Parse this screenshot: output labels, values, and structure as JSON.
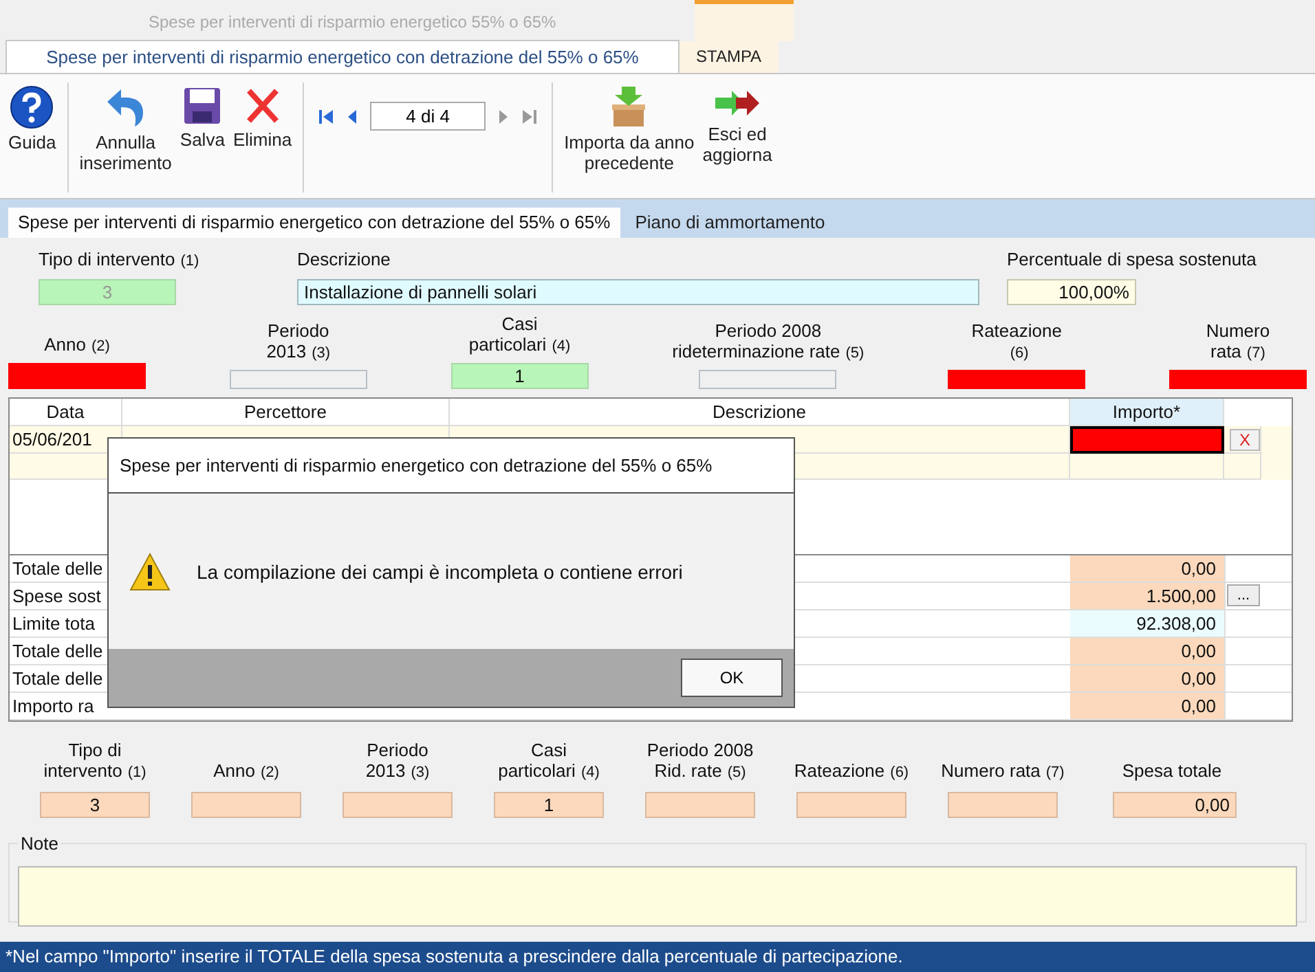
{
  "window": {
    "title": "Spese per interventi di risparmio energetico 55% o 65%"
  },
  "ribbon_tabs": [
    {
      "label": "Spese per interventi di risparmio energetico con detrazione del 55% o 65%",
      "selected": true
    },
    {
      "label": "STAMPA",
      "selected": false
    }
  ],
  "toolbar": {
    "groups": [
      [
        {
          "kind": "help",
          "label": "Guida"
        }
      ],
      [
        {
          "kind": "undo",
          "label": "Annulla\ninserimento"
        },
        {
          "kind": "save",
          "label": "Salva"
        },
        {
          "kind": "delete",
          "label": "Elimina"
        }
      ],
      [
        {
          "kind": "navigator",
          "value": "4 di 4"
        }
      ],
      [
        {
          "kind": "import",
          "label": "Importa da anno\nprecedente"
        },
        {
          "kind": "exit",
          "label": "Esci ed\naggiorna"
        }
      ]
    ]
  },
  "page_tabs": [
    {
      "label": "Spese per interventi di risparmio energetico con detrazione del 55% o 65%",
      "selected": true
    },
    {
      "label": "Piano di ammortamento",
      "selected": false
    }
  ],
  "header_fields": [
    {
      "label": "Tipo di intervento",
      "ref": "(1)",
      "value": "3",
      "kind": "ok",
      "disabled": true
    },
    {
      "label": "Descrizione",
      "value": "Installazione di pannelli solari",
      "kind": "info",
      "disabled": false
    },
    {
      "label": "Percentuale di spesa sostenuta",
      "value": "100,00%",
      "kind": "note",
      "disabled": false
    }
  ],
  "rate_fields": [
    {
      "label": "Anno",
      "ref": "(2)",
      "kind": "error"
    },
    {
      "label": "Periodo\n2013",
      "ref": "(3)",
      "kind": "empty"
    },
    {
      "label": "Casi\nparticolari",
      "ref": "(4)",
      "value": "1",
      "kind": "ok"
    },
    {
      "label": "Periodo 2008\nrideterminazione rate",
      "ref": "(5)",
      "kind": "empty"
    },
    {
      "label": "Rateazione\n",
      "ref": "(6)",
      "kind": "error"
    },
    {
      "label": "Numero\nrata",
      "ref": "(7)",
      "kind": "error"
    }
  ],
  "grid": {
    "columns": [
      "Data",
      "Percettore",
      "Descrizione",
      "Importo*"
    ],
    "rows": [
      {
        "data": "05/06/201",
        "importo_error": true,
        "delete": "X"
      },
      {
        "importo_error": false
      }
    ],
    "totals": [
      {
        "label": "Totale delle",
        "value": "0,00",
        "kind": "calc"
      },
      {
        "label": "Spese sost",
        "value": "1.500,00",
        "kind": "calc",
        "button": "..."
      },
      {
        "label": "Limite tota",
        "value": "92.308,00",
        "kind": "limit"
      },
      {
        "label": "Totale delle",
        "value": "0,00",
        "kind": "calc"
      },
      {
        "label": "Totale delle",
        "value": "0,00",
        "kind": "calc"
      },
      {
        "label": "Importo ra",
        "value": "0,00",
        "kind": "calc"
      }
    ]
  },
  "summary": [
    {
      "label": "Tipo di\nintervento",
      "ref": "(1)",
      "value": "3"
    },
    {
      "label": "Anno",
      "ref": "(2)"
    },
    {
      "label": "Periodo\n2013",
      "ref": "(3)"
    },
    {
      "label": "Casi\nparticolari",
      "ref": "(4)",
      "value": "1"
    },
    {
      "label": "Periodo 2008\nRid. rate",
      "ref": "(5)"
    },
    {
      "label": "Rateazione",
      "ref": "(6)"
    },
    {
      "label": "Numero rata",
      "ref": "(7)"
    },
    {
      "label": "Spesa totale",
      "value": "0,00"
    }
  ],
  "note": {
    "label": "Note"
  },
  "status_bar": "*Nel campo \"Importo\" inserire il TOTALE della spesa sostenuta a prescindere dalla percentuale di partecipazione.",
  "dialog": {
    "title": "Spese per interventi di risparmio energetico con detrazione del 55% o 65%",
    "message": "La compilazione dei campi è incompleta o contiene errori",
    "button": "OK"
  }
}
